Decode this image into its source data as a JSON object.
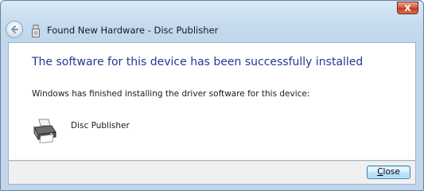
{
  "window": {
    "title": "Found New Hardware - Disc Publisher",
    "close_glyph": "X"
  },
  "content": {
    "heading": "The software for this device has been successfully installed",
    "message": "Windows has finished installing the driver software for this device:",
    "device_name": "Disc Publisher"
  },
  "footer": {
    "close_label_mnemonic": "C",
    "close_label_rest": "lose"
  },
  "colors": {
    "heading": "#1e3b96",
    "accent_close": "#c43b21"
  },
  "icons": {
    "back": "back-arrow-icon",
    "hardware": "usb-hardware-icon",
    "device": "printer-icon",
    "close": "close-x-icon"
  }
}
